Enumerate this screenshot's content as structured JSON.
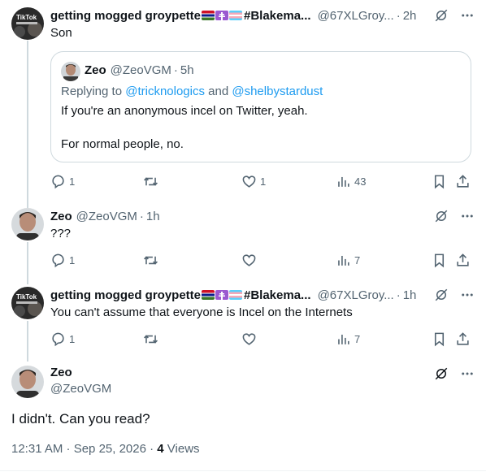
{
  "tweets": [
    {
      "name": "getting mogged groypette",
      "hashtag": "#Blakema...",
      "handle": "@67XLGroy...",
      "time": "2h",
      "text": "Son",
      "stats": {
        "replies": "1",
        "likes": "1",
        "views": "43"
      }
    },
    {
      "name": "Zeo",
      "handle": "@ZeoVGM",
      "time": "1h",
      "text": "???",
      "stats": {
        "replies": "1",
        "views": "7"
      }
    },
    {
      "name": "getting mogged groypette",
      "hashtag": "#Blakema...",
      "handle": "@67XLGroy...",
      "time": "1h",
      "text": "You can't assume that everyone is Incel on the Internets",
      "stats": {
        "replies": "1",
        "views": "7"
      }
    }
  ],
  "quote": {
    "name": "Zeo",
    "handle": "@ZeoVGM",
    "time": "5h",
    "replying_prefix": "Replying to ",
    "replying_user1": "@tricknologics",
    "replying_and": " and ",
    "replying_user2": "@shelbystardust",
    "text1": "If you're an anonymous incel on Twitter, yeah.",
    "text2": "For normal people, no."
  },
  "main": {
    "name": "Zeo",
    "handle": "@ZeoVGM",
    "text": "I didn't. Can you read?",
    "timestamp": "12:31 AM · Sep 25, 2026 · ",
    "views_count": "4",
    "views_label": " Views"
  },
  "separator": "·",
  "icons": [
    "reply-icon",
    "retweet-icon",
    "like-icon",
    "views-icon",
    "bookmark-icon",
    "share-icon",
    "grok-icon",
    "more-icon"
  ],
  "colors": {
    "text": "#0f1419",
    "secondary": "#536471",
    "link": "#1d9bf0",
    "border": "#cfd9de"
  }
}
